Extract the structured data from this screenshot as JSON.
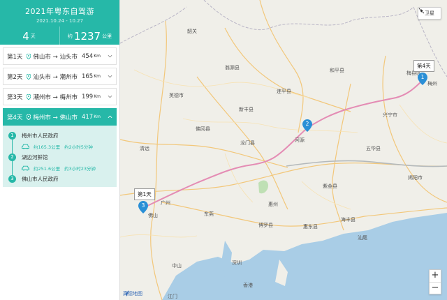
{
  "trip": {
    "title": "2021年粤东自驾游",
    "dates": "2021.10.24 - 10.27",
    "days_num": "4",
    "days_unit": "天",
    "dist_prefix": "约",
    "dist_num": "1237",
    "dist_unit": "公里"
  },
  "days": [
    {
      "label": "第1天",
      "route": "佛山市 → 汕头市",
      "km": "454",
      "unit": "Km",
      "active": false
    },
    {
      "label": "第2天",
      "route": "汕头市 → 潮州市",
      "km": "165",
      "unit": "Km",
      "active": false
    },
    {
      "label": "第3天",
      "route": "潮州市 → 梅州市",
      "km": "199",
      "unit": "Km",
      "active": false
    },
    {
      "label": "第4天",
      "route": "梅州市 → 佛山市",
      "km": "417",
      "unit": "Km",
      "active": true
    }
  ],
  "detail": {
    "stops": [
      {
        "num": "1",
        "name": "梅州市人民政府"
      },
      {
        "num": "2",
        "name": "湖边河鲜馆"
      },
      {
        "num": "3",
        "name": "佛山市人民政府"
      }
    ],
    "segments": [
      {
        "dist": "约165.3公里",
        "time": "约2小时5分钟"
      },
      {
        "dist": "约251.6公里",
        "time": "约3小时23分钟"
      }
    ]
  },
  "map": {
    "satellite_label": "卫星",
    "zoom_in": "+",
    "zoom_out": "−",
    "logo": "高德地图",
    "day_tag_start": "第1天",
    "day_tag_end": "第4天",
    "markers": [
      "1",
      "2",
      "3"
    ],
    "cities": [
      "韶关",
      "清远",
      "河源",
      "梅州",
      "广州",
      "佛山",
      "东莞",
      "惠州",
      "深圳",
      "香港",
      "中山",
      "江门",
      "汕尾",
      "揭阳市",
      "梅县区",
      "新丰县",
      "龙门县",
      "佛冈县",
      "博罗县",
      "惠东县",
      "海丰县",
      "紫金县",
      "五华县",
      "兴宁市",
      "连平县",
      "和平县",
      "翁源县",
      "英德市"
    ],
    "colors": {
      "accent": "#26b8a8",
      "route": "#e48cb4",
      "marker": "#2a8fd6",
      "water": "#a9cde6",
      "land": "#f0efe9"
    }
  }
}
